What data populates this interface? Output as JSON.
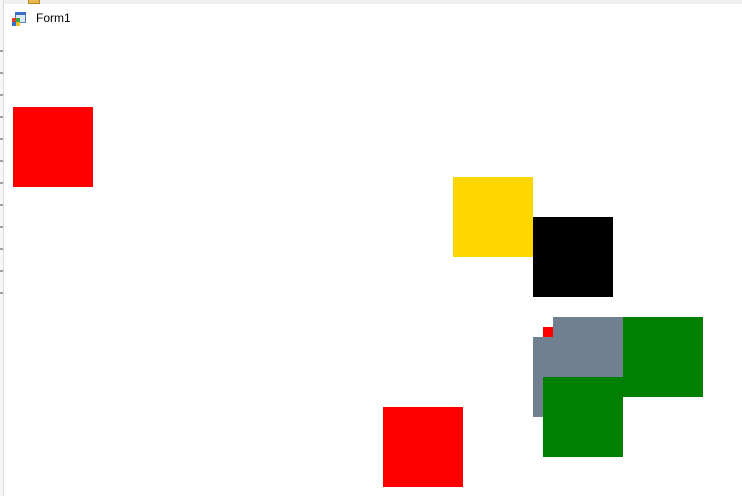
{
  "window": {
    "title": "Form1",
    "icon": "windows-form-icon"
  },
  "colors": {
    "red": "#ff0000",
    "gold": "#ffd700",
    "black": "#000000",
    "slategray": "#708090",
    "green": "#008000",
    "background": "#ffffff"
  }
}
